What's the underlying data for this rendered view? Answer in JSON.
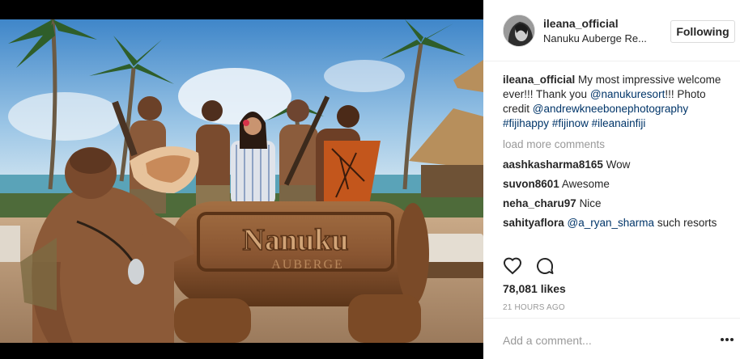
{
  "post": {
    "username": "ileana_official",
    "location": "Nanuku Auberge Re...",
    "follow_label": "Following",
    "photo_sign_main": "Nanuku",
    "photo_sign_sub": "AUBERGE"
  },
  "caption": {
    "username": "ileana_official",
    "text": " My most impressive welcome ever!!! Thank you ",
    "mention": "@nanukuresort",
    "text2": "!!! Photo credit ",
    "mention2": "@andrewkneebonephotography",
    "tags": [
      "#fijihappy",
      "#fijinow",
      "#ileanainfiji"
    ]
  },
  "load_more": "load more comments",
  "comments": [
    {
      "user": "aashkasharma8165",
      "text": "Wow"
    },
    {
      "user": "suvon8601",
      "text": "Awesome"
    },
    {
      "user": "neha_charu97",
      "text": "Nice"
    },
    {
      "user": "sahityaflora",
      "mention": "@a_ryan_sharma",
      "text": " such resorts"
    }
  ],
  "likes": "78,081 likes",
  "timestamp": "21 HOURS AGO",
  "add_comment_placeholder": "Add a comment...",
  "icons": {
    "like": "heart-icon",
    "comment": "comment-bubble-icon",
    "more": "more-options-icon"
  }
}
